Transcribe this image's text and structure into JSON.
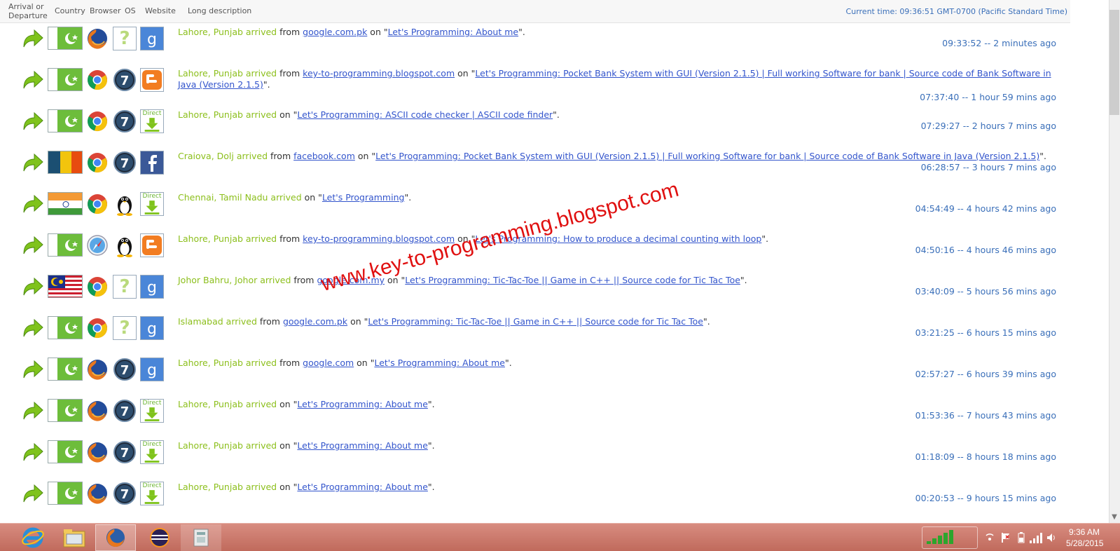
{
  "header": {
    "arrival_label": "Arrival or Departure",
    "country_label": "Country",
    "browser_label": "Browser",
    "os_label": "OS",
    "website_label": "Website",
    "long_label": "Long description",
    "current_time": "Current time: 09:36:51 GMT-0700 (Pacific Standard Time)"
  },
  "rows": [
    {
      "flag": "pk",
      "browser": "firefox",
      "os": "unknown",
      "site": "google",
      "location": "Lahore, Punjab arrived",
      "from_word": " from ",
      "referrer": "google.com.pk",
      "on_word": " on \"",
      "page": "Let's Programming: About me",
      "end": "\".",
      "time": "09:33:52 -- 2 minutes ago"
    },
    {
      "flag": "pk",
      "browser": "chrome",
      "os": "win7",
      "site": "blogger",
      "location": "Lahore, Punjab arrived",
      "from_word": " from ",
      "referrer": "key-to-programming.blogspot.com",
      "on_word": " on \"",
      "page": "Let's Programming: Pocket Bank System with GUI (Version 2.1.5) | Full working Software for bank | Source code of Bank Software in Java (Version 2.1.5)",
      "end": "\".",
      "time": "07:37:40 -- 1 hour 59 mins ago"
    },
    {
      "flag": "pk",
      "browser": "chrome",
      "os": "win7",
      "site": "direct",
      "location": "Lahore, Punjab arrived",
      "from_word": "",
      "referrer": "",
      "on_word": " on \"",
      "page": "Let's Programming: ASCII code checker | ASCII code finder",
      "end": "\".",
      "time": "07:29:27 -- 2 hours 7 mins ago"
    },
    {
      "flag": "ro",
      "browser": "chrome",
      "os": "win7",
      "site": "facebook",
      "location": "Craiova, Dolj arrived",
      "from_word": " from ",
      "referrer": "facebook.com",
      "on_word": " on \"",
      "page": "Let's Programming: Pocket Bank System with GUI (Version 2.1.5) | Full working Software for bank | Source code of Bank Software in Java (Version 2.1.5)",
      "end": "\".",
      "time": "06:28:57 -- 3 hours 7 mins ago"
    },
    {
      "flag": "in",
      "browser": "chrome",
      "os": "linux",
      "site": "direct",
      "location": "Chennai, Tamil Nadu arrived",
      "from_word": "",
      "referrer": "",
      "on_word": " on \"",
      "page": "Let's Programming",
      "end": "\".",
      "time": "04:54:49 -- 4 hours 42 mins ago"
    },
    {
      "flag": "pk",
      "browser": "safari",
      "os": "linux",
      "site": "blogger",
      "location": "Lahore, Punjab arrived",
      "from_word": " from ",
      "referrer": "key-to-programming.blogspot.com",
      "on_word": " on \"",
      "page": "Let's Programming: How to produce a decimal counting with loop",
      "end": "\".",
      "time": "04:50:16 -- 4 hours 46 mins ago"
    },
    {
      "flag": "my",
      "browser": "chrome",
      "os": "unknown",
      "site": "google",
      "location": "Johor Bahru, Johor arrived",
      "from_word": " from ",
      "referrer": "google.com.my",
      "on_word": " on \"",
      "page": "Let's Programming: Tic-Tac-Toe || Game in C++ || Source code for Tic Tac Toe",
      "end": "\".",
      "time": "03:40:09 -- 5 hours 56 mins ago"
    },
    {
      "flag": "pk",
      "browser": "chrome",
      "os": "unknown",
      "site": "google",
      "location": "Islamabad arrived",
      "from_word": " from ",
      "referrer": "google.com.pk",
      "on_word": " on \"",
      "page": "Let's Programming: Tic-Tac-Toe || Game in C++ || Source code for Tic Tac Toe",
      "end": "\".",
      "time": "03:21:25 -- 6 hours 15 mins ago"
    },
    {
      "flag": "pk",
      "browser": "firefox",
      "os": "win7",
      "site": "google",
      "location": "Lahore, Punjab arrived",
      "from_word": " from ",
      "referrer": "google.com",
      "on_word": " on \"",
      "page": "Let's Programming: About me",
      "end": "\".",
      "time": "02:57:27 -- 6 hours 39 mins ago"
    },
    {
      "flag": "pk",
      "browser": "firefox",
      "os": "win7",
      "site": "direct",
      "location": "Lahore, Punjab arrived",
      "from_word": "",
      "referrer": "",
      "on_word": " on \"",
      "page": "Let's Programming: About me",
      "end": "\".",
      "time": "01:53:36 -- 7 hours 43 mins ago"
    },
    {
      "flag": "pk",
      "browser": "firefox",
      "os": "win7",
      "site": "direct",
      "location": "Lahore, Punjab arrived",
      "from_word": "",
      "referrer": "",
      "on_word": " on \"",
      "page": "Let's Programming: About me",
      "end": "\".",
      "time": "01:18:09 -- 8 hours 18 mins ago"
    },
    {
      "flag": "pk",
      "browser": "firefox",
      "os": "win7",
      "site": "direct",
      "location": "Lahore, Punjab arrived",
      "from_word": "",
      "referrer": "",
      "on_word": " on \"",
      "page": "Let's Programming: About me",
      "end": "\".",
      "time": "00:20:53 -- 9 hours 15 mins ago"
    }
  ],
  "direct_label": "Direct",
  "unknown_os_label": "?",
  "win7_label": "7",
  "watermark": "www.key-to-programming.blogspot.com",
  "taskbar": {
    "apps": [
      "ie-icon",
      "explorer-icon",
      "firefox-icon",
      "eclipse-icon",
      "app-icon"
    ],
    "clock_time": "9:36 AM",
    "clock_date": "5/28/2015"
  },
  "colors": {
    "location": "#8cbf1c",
    "link": "#3355cc",
    "time": "#3a6fb9",
    "watermark": "#e01010"
  }
}
